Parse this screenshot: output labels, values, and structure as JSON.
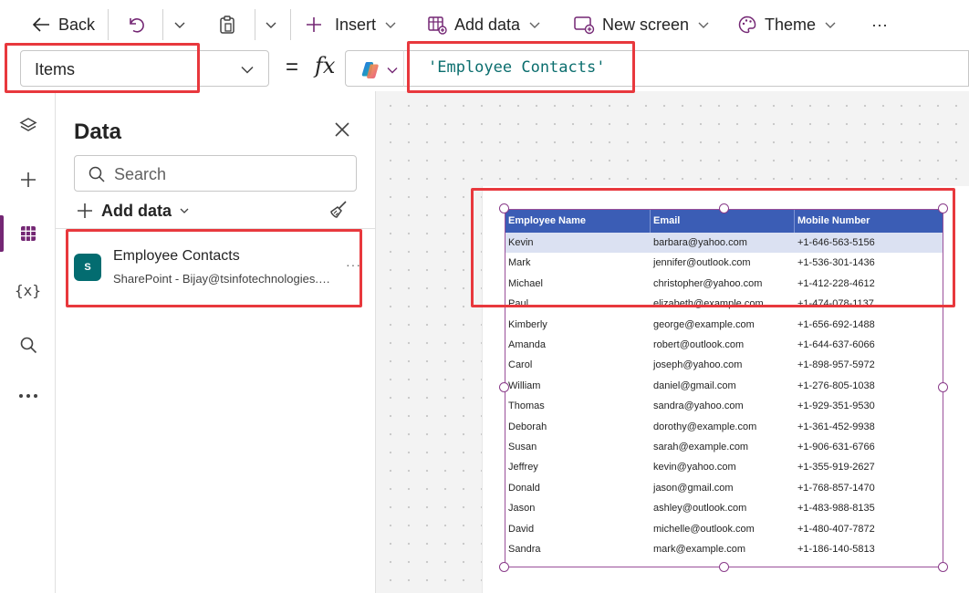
{
  "toolbar": {
    "back_label": "Back",
    "insert_label": "Insert",
    "add_data_label": "Add data",
    "new_screen_label": "New screen",
    "theme_label": "Theme",
    "more": "···"
  },
  "formula_bar": {
    "property": "Items",
    "equals": "=",
    "fx": "fx",
    "formula": "'Employee Contacts'"
  },
  "data_panel": {
    "title": "Data",
    "search_placeholder": "Search",
    "add_data_label": "Add data",
    "source": {
      "name": "Employee Contacts",
      "subtitle": "SharePoint - Bijay@tsinfotechnologies.o...",
      "logo_letter": "S",
      "more": "···"
    }
  },
  "rail": {
    "items": [
      "layers-icon",
      "plus-icon",
      "data-icon",
      "variables-icon",
      "search-icon",
      "more-icon"
    ],
    "variables_glyph": "{x}",
    "active": "data-icon"
  },
  "grid": {
    "columns": [
      "Employee Name",
      "Email",
      "Mobile Number"
    ],
    "rows": [
      [
        "Kevin",
        "barbara@yahoo.com",
        "+1-646-563-5156"
      ],
      [
        "Mark",
        "jennifer@outlook.com",
        "+1-536-301-1436"
      ],
      [
        "Michael",
        "christopher@yahoo.com",
        "+1-412-228-4612"
      ],
      [
        "Paul",
        "elizabeth@example.com",
        "+1-474-078-1137"
      ],
      [
        "Kimberly",
        "george@example.com",
        "+1-656-692-1488"
      ],
      [
        "Amanda",
        "robert@outlook.com",
        "+1-644-637-6066"
      ],
      [
        "Carol",
        "joseph@yahoo.com",
        "+1-898-957-5972"
      ],
      [
        "William",
        "daniel@gmail.com",
        "+1-276-805-1038"
      ],
      [
        "Thomas",
        "sandra@yahoo.com",
        "+1-929-351-9530"
      ],
      [
        "Deborah",
        "dorothy@example.com",
        "+1-361-452-9938"
      ],
      [
        "Susan",
        "sarah@example.com",
        "+1-906-631-6766"
      ],
      [
        "Jeffrey",
        "kevin@yahoo.com",
        "+1-355-919-2627"
      ],
      [
        "Donald",
        "jason@gmail.com",
        "+1-768-857-1470"
      ],
      [
        "Jason",
        "ashley@outlook.com",
        "+1-483-988-8135"
      ],
      [
        "David",
        "michelle@outlook.com",
        "+1-480-407-7872"
      ],
      [
        "Sandra",
        "mark@example.com",
        "+1-186-140-5813"
      ]
    ],
    "selected_row": 0
  },
  "colors": {
    "accent": "#742774",
    "grid_header": "#3b5db5",
    "selected_row": "#dbe1f2",
    "highlight": "#e8383d",
    "formula_text": "#0b6e6e"
  }
}
